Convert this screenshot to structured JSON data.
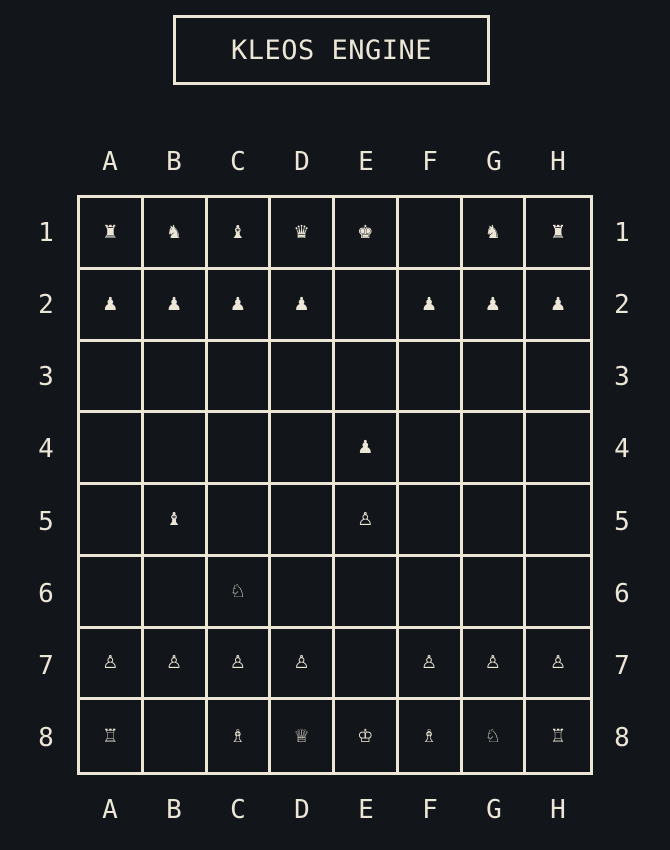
{
  "title": "KLEOS ENGINE",
  "files": [
    "A",
    "B",
    "C",
    "D",
    "E",
    "F",
    "G",
    "H"
  ],
  "ranks": [
    "1",
    "2",
    "3",
    "4",
    "5",
    "6",
    "7",
    "8"
  ],
  "colors": {
    "background": "#12161b",
    "foreground": "#ece6d6"
  },
  "board": [
    [
      {
        "glyph": "♜",
        "piece": "black-rook"
      },
      {
        "glyph": "♞",
        "piece": "black-knight"
      },
      {
        "glyph": "♝",
        "piece": "black-bishop"
      },
      {
        "glyph": "♛",
        "piece": "black-queen"
      },
      {
        "glyph": "♚",
        "piece": "black-king"
      },
      {
        "glyph": "",
        "piece": ""
      },
      {
        "glyph": "♞",
        "piece": "black-knight"
      },
      {
        "glyph": "♜",
        "piece": "black-rook"
      }
    ],
    [
      {
        "glyph": "♟",
        "piece": "black-pawn"
      },
      {
        "glyph": "♟",
        "piece": "black-pawn"
      },
      {
        "glyph": "♟",
        "piece": "black-pawn"
      },
      {
        "glyph": "♟",
        "piece": "black-pawn"
      },
      {
        "glyph": "",
        "piece": ""
      },
      {
        "glyph": "♟",
        "piece": "black-pawn"
      },
      {
        "glyph": "♟",
        "piece": "black-pawn"
      },
      {
        "glyph": "♟",
        "piece": "black-pawn"
      }
    ],
    [
      {
        "glyph": "",
        "piece": ""
      },
      {
        "glyph": "",
        "piece": ""
      },
      {
        "glyph": "",
        "piece": ""
      },
      {
        "glyph": "",
        "piece": ""
      },
      {
        "glyph": "",
        "piece": ""
      },
      {
        "glyph": "",
        "piece": ""
      },
      {
        "glyph": "",
        "piece": ""
      },
      {
        "glyph": "",
        "piece": ""
      }
    ],
    [
      {
        "glyph": "",
        "piece": ""
      },
      {
        "glyph": "",
        "piece": ""
      },
      {
        "glyph": "",
        "piece": ""
      },
      {
        "glyph": "",
        "piece": ""
      },
      {
        "glyph": "♟",
        "piece": "black-pawn"
      },
      {
        "glyph": "",
        "piece": ""
      },
      {
        "glyph": "",
        "piece": ""
      },
      {
        "glyph": "",
        "piece": ""
      }
    ],
    [
      {
        "glyph": "",
        "piece": ""
      },
      {
        "glyph": "♝",
        "piece": "black-bishop"
      },
      {
        "glyph": "",
        "piece": ""
      },
      {
        "glyph": "",
        "piece": ""
      },
      {
        "glyph": "♙",
        "piece": "white-pawn"
      },
      {
        "glyph": "",
        "piece": ""
      },
      {
        "glyph": "",
        "piece": ""
      },
      {
        "glyph": "",
        "piece": ""
      }
    ],
    [
      {
        "glyph": "",
        "piece": ""
      },
      {
        "glyph": "",
        "piece": ""
      },
      {
        "glyph": "♘",
        "piece": "white-knight"
      },
      {
        "glyph": "",
        "piece": ""
      },
      {
        "glyph": "",
        "piece": ""
      },
      {
        "glyph": "",
        "piece": ""
      },
      {
        "glyph": "",
        "piece": ""
      },
      {
        "glyph": "",
        "piece": ""
      }
    ],
    [
      {
        "glyph": "♙",
        "piece": "white-pawn"
      },
      {
        "glyph": "♙",
        "piece": "white-pawn"
      },
      {
        "glyph": "♙",
        "piece": "white-pawn"
      },
      {
        "glyph": "♙",
        "piece": "white-pawn"
      },
      {
        "glyph": "",
        "piece": ""
      },
      {
        "glyph": "♙",
        "piece": "white-pawn"
      },
      {
        "glyph": "♙",
        "piece": "white-pawn"
      },
      {
        "glyph": "♙",
        "piece": "white-pawn"
      }
    ],
    [
      {
        "glyph": "♖",
        "piece": "white-rook"
      },
      {
        "glyph": "",
        "piece": ""
      },
      {
        "glyph": "♗",
        "piece": "white-bishop"
      },
      {
        "glyph": "♕",
        "piece": "white-queen"
      },
      {
        "glyph": "♔",
        "piece": "white-king"
      },
      {
        "glyph": "♗",
        "piece": "white-bishop"
      },
      {
        "glyph": "♘",
        "piece": "white-knight"
      },
      {
        "glyph": "♖",
        "piece": "white-rook"
      }
    ]
  ]
}
